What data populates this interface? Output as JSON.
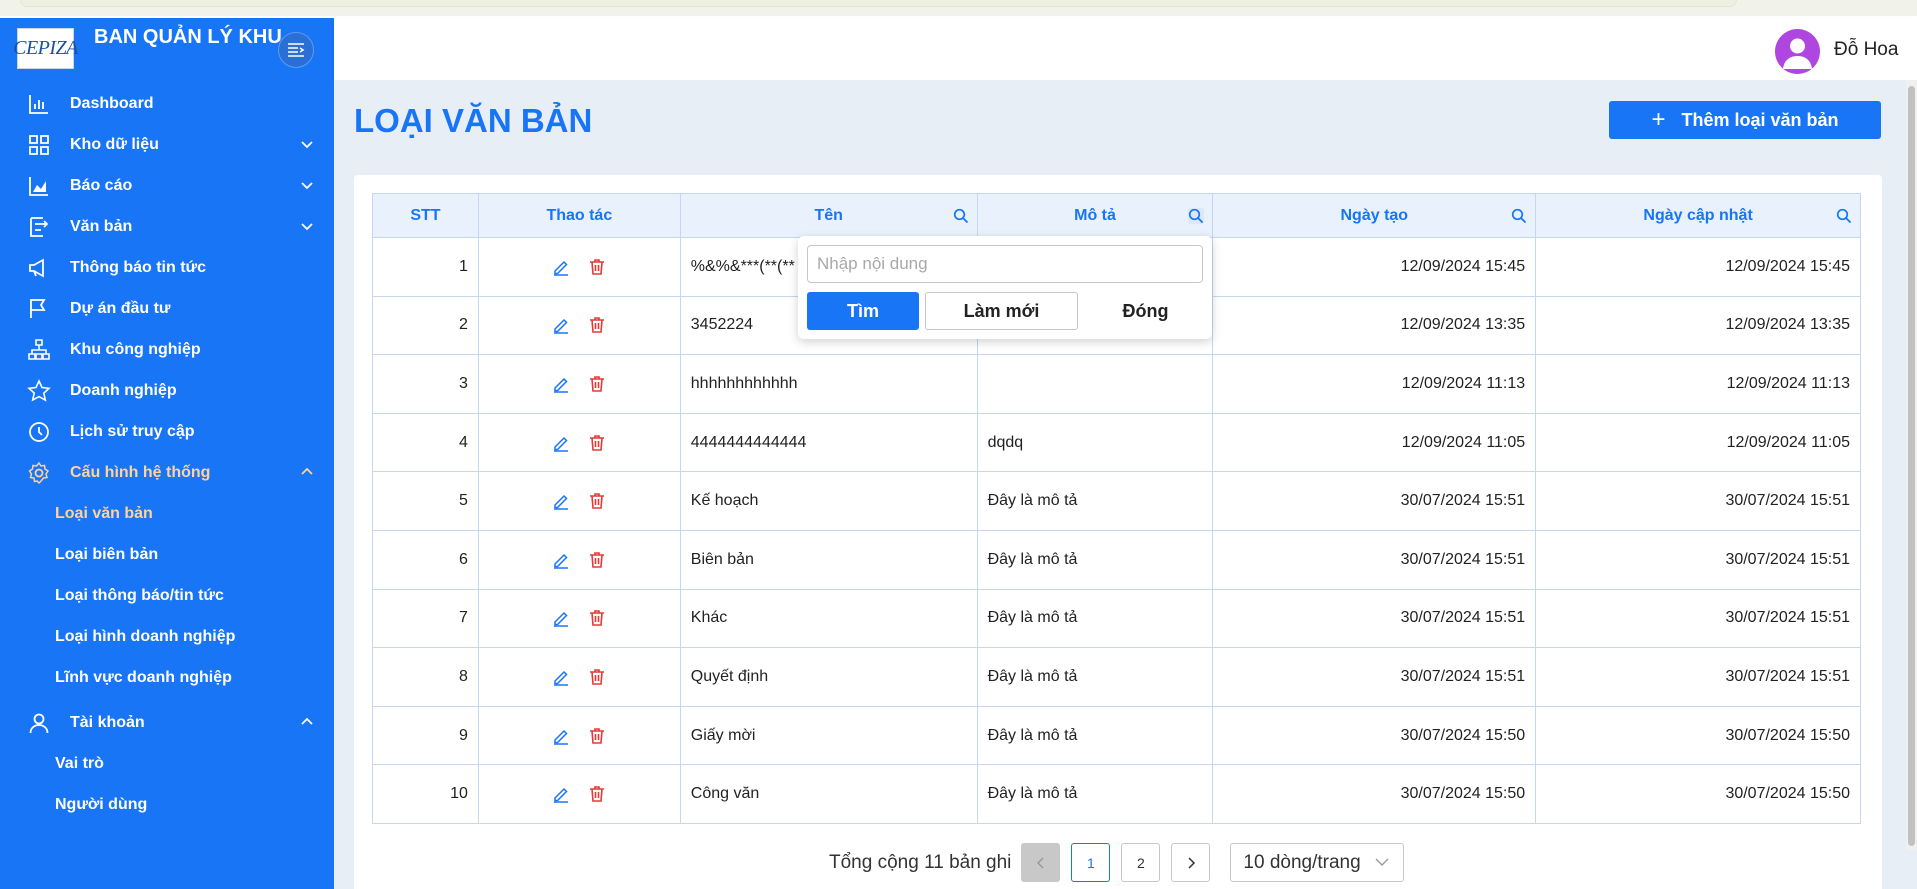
{
  "app": {
    "logo_text": "CEPIZA",
    "title": "BAN QUẢN LÝ KHU CHẾ XUẤT KHU CN"
  },
  "user": {
    "name": "Đỗ Hoa"
  },
  "sidebar": {
    "items": [
      {
        "label": "Dashboard"
      },
      {
        "label": "Kho dữ liệu"
      },
      {
        "label": "Báo cáo"
      },
      {
        "label": "Văn bản"
      },
      {
        "label": "Thông báo tin tức"
      },
      {
        "label": "Dự án đầu tư"
      },
      {
        "label": "Khu công nghiệp"
      },
      {
        "label": "Doanh nghiệp"
      },
      {
        "label": "Lịch sử truy cập"
      },
      {
        "label": "Cấu hình hệ thống"
      },
      {
        "label": "Tài khoản"
      }
    ],
    "config_sub": [
      {
        "label": "Loại văn bản"
      },
      {
        "label": "Loại biên bản"
      },
      {
        "label": "Loại thông báo/tin tức"
      },
      {
        "label": "Loại hình doanh nghiệp"
      },
      {
        "label": "Lĩnh vực doanh nghiệp"
      }
    ],
    "account_sub": [
      {
        "label": "Vai trò"
      },
      {
        "label": "Người dùng"
      }
    ]
  },
  "page": {
    "title": "LOẠI VĂN BẢN",
    "add_label": "Thêm loại văn bản"
  },
  "table": {
    "headers": [
      "STT",
      "Thao tác",
      "Tên",
      "Mô tả",
      "Ngày tạo",
      "Ngày cập nhật"
    ],
    "rows": [
      [
        "1",
        "%&%&***(**(**",
        "",
        "12/09/2024 15:45",
        "12/09/2024 15:45"
      ],
      [
        "2",
        "3452224",
        "",
        "12/09/2024 13:35",
        "12/09/2024 13:35"
      ],
      [
        "3",
        "hhhhhhhhhhhh",
        "",
        "12/09/2024 11:13",
        "12/09/2024 11:13"
      ],
      [
        "4",
        "4444444444444",
        "dqdq",
        "12/09/2024 11:05",
        "12/09/2024 11:05"
      ],
      [
        "5",
        "Kế hoạch",
        "Đây là mô tả",
        "30/07/2024 15:51",
        "30/07/2024 15:51"
      ],
      [
        "6",
        "Biên bản",
        "Đây là mô tả",
        "30/07/2024 15:51",
        "30/07/2024 15:51"
      ],
      [
        "7",
        "Khác",
        "Đây là mô tả",
        "30/07/2024 15:51",
        "30/07/2024 15:51"
      ],
      [
        "8",
        "Quyết định",
        "Đây là mô tả",
        "30/07/2024 15:51",
        "30/07/2024 15:51"
      ],
      [
        "9",
        "Giấy mời",
        "Đây là mô tả",
        "30/07/2024 15:50",
        "30/07/2024 15:50"
      ],
      [
        "10",
        "Công văn",
        "Đây là mô tả",
        "30/07/2024 15:50",
        "30/07/2024 15:50"
      ]
    ]
  },
  "filter_popup": {
    "placeholder": "Nhập nội dung",
    "find_label": "Tìm",
    "reset_label": "Làm mới",
    "close_label": "Đóng"
  },
  "pagination": {
    "total_text": "Tổng cộng 11 bản ghi",
    "pages": [
      "1",
      "2"
    ],
    "current_page": "1",
    "page_size": "10 dòng/trang"
  },
  "colors": {
    "primary": "#1875f5",
    "active_menu": "#ffd39b",
    "delete": "#e53935"
  }
}
